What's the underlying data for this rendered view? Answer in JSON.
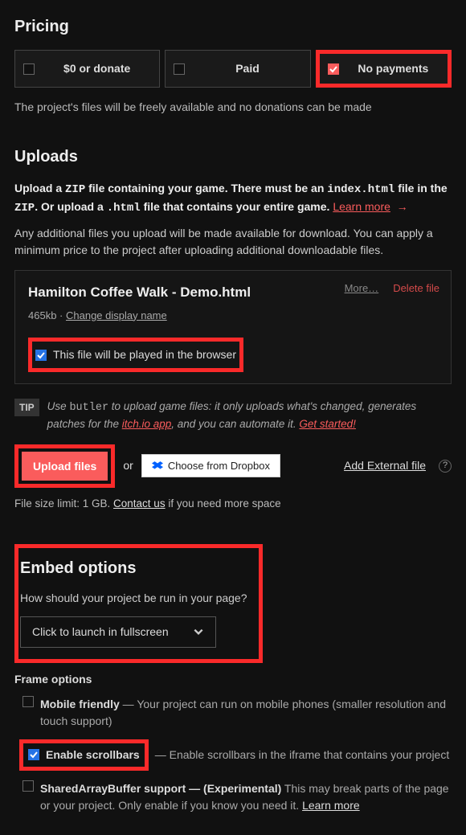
{
  "pricing": {
    "title": "Pricing",
    "options": [
      {
        "label": "$0 or donate",
        "checked": false
      },
      {
        "label": "Paid",
        "checked": false
      },
      {
        "label": "No payments",
        "checked": true
      }
    ],
    "description": "The project's files will be freely available and no donations can be made"
  },
  "uploads": {
    "title": "Uploads",
    "instr_pre": "Upload a ",
    "zip": "ZIP",
    "instr_mid1": " file containing your game. There must be an ",
    "index": "index.html",
    "instr_mid2": " file in the ",
    "zip2": "ZIP",
    "instr_mid3": ". Or upload a ",
    "html_ext": ".html",
    "instr_end": " file that contains your entire game. ",
    "learn_more": "Learn more",
    "additional": "Any additional files you upload will be made available for download. You can apply a minimum price to the project after uploading additional downloadable files.",
    "file": {
      "name": "Hamilton Coffee Walk - Demo.html",
      "size": "465kb",
      "change": "Change display name",
      "more": "More…",
      "delete": "Delete file",
      "play_label": "This file will be played in the browser"
    },
    "tip": {
      "badge": "TIP",
      "pre": "Use ",
      "butler": "butler",
      "mid": " to upload game files: it only uploads what's changed, generates patches for the ",
      "app": "itch.io app",
      "mid2": ", and you can automate it. ",
      "get_started": "Get started!"
    },
    "upload_btn": "Upload files",
    "or": "or",
    "dropbox": "Choose from Dropbox",
    "external": "Add External file",
    "limit_pre": "File size limit: 1 GB. ",
    "contact": "Contact us",
    "limit_post": " if you need more space"
  },
  "embed": {
    "title": "Embed options",
    "question": "How should your project be run in your page?",
    "select_value": "Click to launch in fullscreen"
  },
  "frame": {
    "title": "Frame options",
    "mobile": {
      "label": "Mobile friendly",
      "desc": " — Your project can run on mobile phones (smaller resolution and touch support)"
    },
    "scrollbars": {
      "label": "Enable scrollbars",
      "desc_pre": " — ",
      "desc": "Enable scrollbars in the iframe that contains your project"
    },
    "sab": {
      "label": "SharedArrayBuffer support",
      "exp": " — (Experimental)",
      "desc": " This may break parts of the page or your project. Only enable if you know you need it. ",
      "learn": "Learn more"
    }
  }
}
